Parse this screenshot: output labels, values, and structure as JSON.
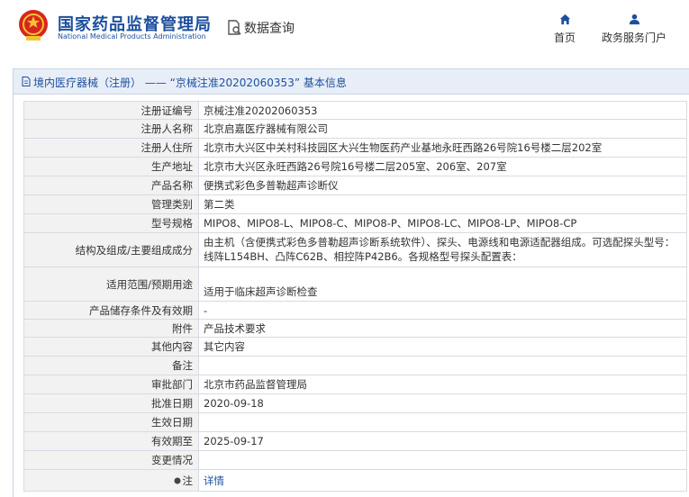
{
  "header": {
    "brand_cn": "国家药品监督管理局",
    "brand_en": "National Medical Products Administration",
    "query_label": "数据查询",
    "nav": {
      "home": "首页",
      "service": "政务服务门户"
    }
  },
  "panel": {
    "title": "境内医疗器械（注册） —— “京械注准20202060353” 基本信息"
  },
  "rows": [
    {
      "label": "注册证编号",
      "value": "京械注准20202060353"
    },
    {
      "label": "注册人名称",
      "value": "北京启嘉医疗器械有限公司"
    },
    {
      "label": "注册人住所",
      "value": "北京市大兴区中关村科技园区大兴生物医药产业基地永旺西路26号院16号楼二层202室"
    },
    {
      "label": "生产地址",
      "value": "北京市大兴区永旺西路26号院16号楼二层205室、206室、207室"
    },
    {
      "label": "产品名称",
      "value": "便携式彩色多普勒超声诊断仪"
    },
    {
      "label": "管理类别",
      "value": "第二类"
    },
    {
      "label": "型号规格",
      "value": "MIPO8、MIPO8-L、MIPO8-C、MIPO8-P、MIPO8-LC、MIPO8-LP、MIPO8-CP"
    },
    {
      "label": "结构及组成/主要组成成分",
      "value": "由主机（含便携式彩色多普勒超声诊断系统软件）、探头、电源线和电源适配器组成。可选配探头型号：线阵L154BH、凸阵C62B、相控阵P42B6。各规格型号探头配置表："
    },
    {
      "label": "适用范围/预期用途",
      "value": "适用于临床超声诊断检查"
    },
    {
      "label": "产品储存条件及有效期",
      "value": "-"
    },
    {
      "label": "附件",
      "value": "产品技术要求"
    },
    {
      "label": "其他内容",
      "value": "其它内容"
    },
    {
      "label": "备注",
      "value": ""
    },
    {
      "label": "审批部门",
      "value": "北京市药品监督管理局"
    },
    {
      "label": "批准日期",
      "value": "2020-09-18"
    },
    {
      "label": "生效日期",
      "value": ""
    },
    {
      "label": "有效期至",
      "value": "2025-09-17"
    },
    {
      "label": "变更情况",
      "value": ""
    },
    {
      "label": "注",
      "value": "详情"
    }
  ],
  "colors": {
    "brand_blue": "#1d4f9e",
    "emblem_red": "#d7261e",
    "emblem_gold": "#f2c530"
  },
  "icons": {
    "home": "home-icon",
    "user": "user-icon",
    "query": "document-search-icon",
    "title": "document-icon",
    "remark": "bullet-icon"
  }
}
